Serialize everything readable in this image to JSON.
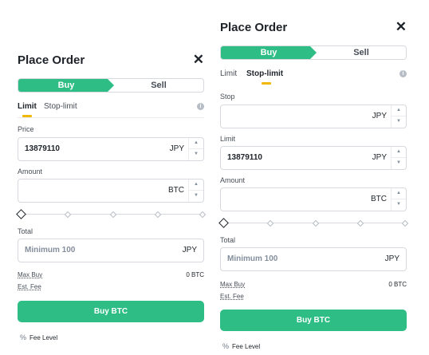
{
  "panels": [
    {
      "title": "Place Order",
      "close_icon": "close-icon",
      "side": {
        "buy": "Buy",
        "sell": "Sell",
        "selected": "Buy"
      },
      "tabs": [
        {
          "label": "Limit",
          "active": true
        },
        {
          "label": "Stop-limit",
          "active": false
        }
      ],
      "info_icon": "info-icon",
      "price": {
        "label": "Price",
        "value": "13879110",
        "unit": "JPY"
      },
      "amount": {
        "label": "Amount",
        "value": "",
        "unit": "BTC"
      },
      "slider_percent": 0,
      "total": {
        "label": "Total",
        "placeholder": "Minimum 100",
        "unit": "JPY"
      },
      "max_buy": {
        "label": "Max Buy",
        "value": "0 BTC"
      },
      "est_fee": {
        "label": "Est. Fee"
      },
      "buy_button": "Buy BTC",
      "fee_level": "Fee Level"
    },
    {
      "title": "Place Order",
      "close_icon": "close-icon",
      "side": {
        "buy": "Buy",
        "sell": "Sell",
        "selected": "Buy"
      },
      "tabs": [
        {
          "label": "Limit",
          "active": false
        },
        {
          "label": "Stop-limit",
          "active": true
        }
      ],
      "info_icon": "info-icon",
      "stop": {
        "label": "Stop",
        "value": "",
        "unit": "JPY"
      },
      "limit": {
        "label": "Limit",
        "value": "13879110",
        "unit": "JPY"
      },
      "amount": {
        "label": "Amount",
        "value": "",
        "unit": "BTC"
      },
      "slider_percent": 0,
      "total": {
        "label": "Total",
        "placeholder": "Minimum 100",
        "unit": "JPY"
      },
      "max_buy": {
        "label": "Max Buy",
        "value": "0 BTC"
      },
      "est_fee": {
        "label": "Est. Fee"
      },
      "buy_button": "Buy BTC",
      "fee_level": "Fee Level"
    }
  ],
  "colors": {
    "buy_green": "#2ebd85",
    "tab_underline": "#f0b90b",
    "text": "#1e2329",
    "muted": "#848e9c",
    "border": "#d6d9dd"
  }
}
